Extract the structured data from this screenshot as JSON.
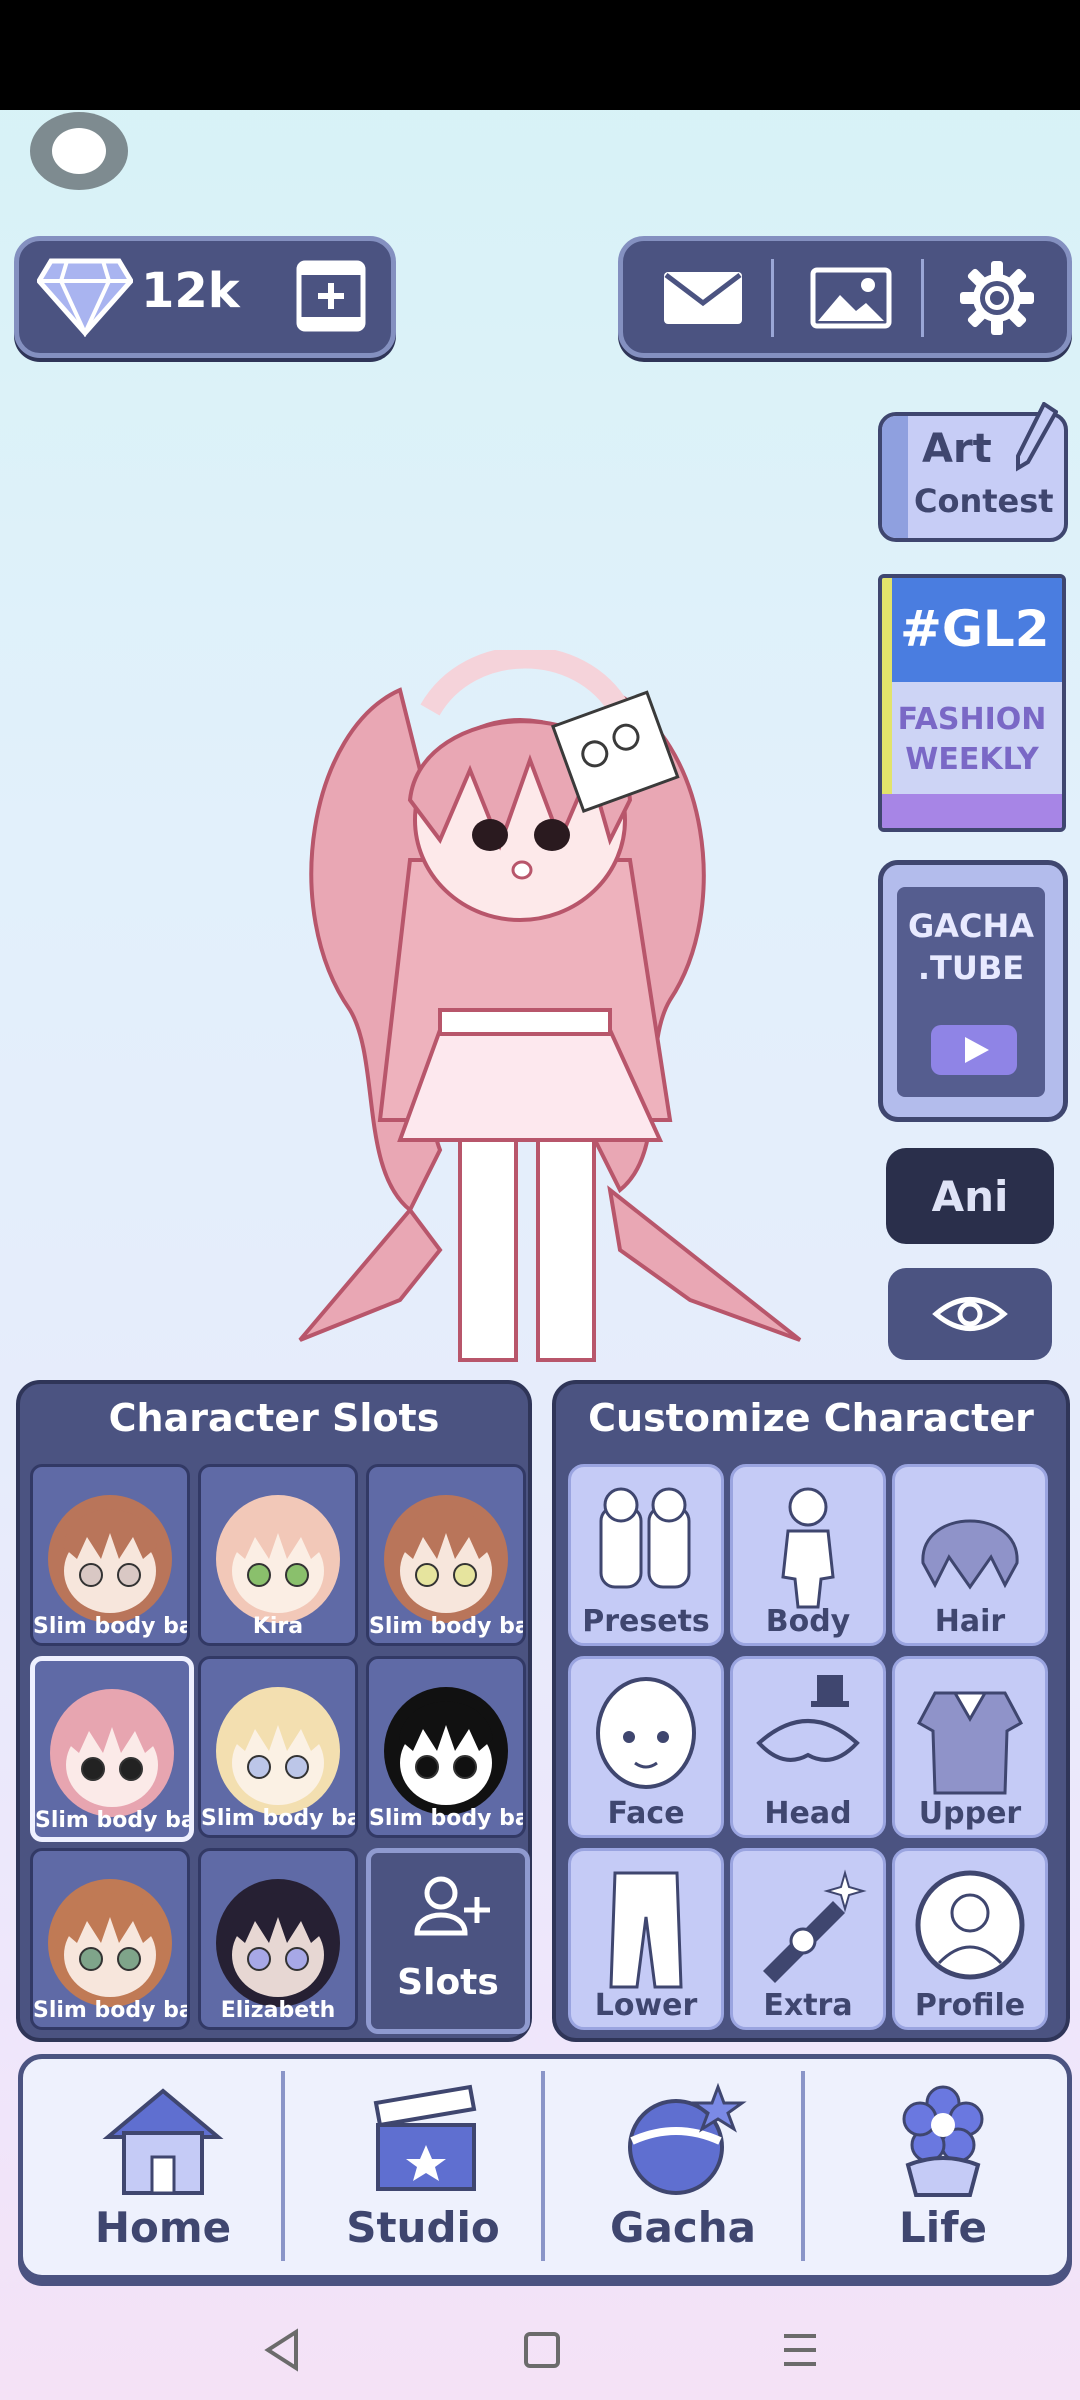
{
  "currency": {
    "amount": "12k"
  },
  "top_right": {
    "icons": [
      "mail-icon",
      "gallery-icon",
      "settings-icon"
    ]
  },
  "side": {
    "art_contest": {
      "line1": "Art",
      "line2": "Contest"
    },
    "fashion": {
      "line0": "#GL2",
      "line1": "FASHION",
      "line2": "WEEKLY"
    },
    "gacha_tube": {
      "line1": "GACHA",
      "line2": ".TUBE"
    },
    "ani_label": "Ani"
  },
  "character_slots": {
    "title": "Character Slots",
    "slots": [
      {
        "name": "Slim body bas",
        "hair": "#b9755a",
        "eye": "#d9c8c4",
        "skin": "#f7e6dc"
      },
      {
        "name": "Kira",
        "hair": "#f2c8b8",
        "eye": "#8ac06c",
        "skin": "#fbeee4"
      },
      {
        "name": "Slim body bas",
        "hair": "#b9755a",
        "eye": "#e6e49e",
        "skin": "#f7e6dc"
      },
      {
        "name": "Slim body bas",
        "hair": "#e7a5b0",
        "eye": "#222222",
        "skin": "#fbeae8"
      },
      {
        "name": "Slim body bas",
        "hair": "#f3dfb0",
        "eye": "#bcc6e8",
        "skin": "#fbf1e4"
      },
      {
        "name": "Slim body bas",
        "hair": "#111111",
        "eye": "#111111",
        "skin": "#ffffff"
      },
      {
        "name": "Slim body bas",
        "hair": "#c07a55",
        "eye": "#7fa48a",
        "skin": "#f7e6dc"
      },
      {
        "name": "Elizabeth",
        "hair": "#262033",
        "eye": "#a7a8e6",
        "skin": "#e7d7d3"
      }
    ],
    "add_label": "Slots"
  },
  "customize": {
    "title": "Customize Character",
    "items": [
      "Presets",
      "Body",
      "Hair",
      "Face",
      "Head",
      "Upper",
      "Lower",
      "Extra",
      "Profile"
    ]
  },
  "nav": {
    "items": [
      "Home",
      "Studio",
      "Gacha",
      "Life"
    ]
  },
  "colors": {
    "panel": "#4b5381",
    "accent": "#c5cbf6",
    "ink": "#3f466f"
  }
}
